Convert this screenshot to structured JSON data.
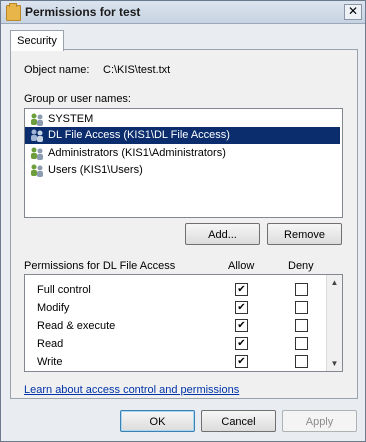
{
  "window": {
    "title": "Permissions for test",
    "close_glyph": "✕"
  },
  "tabs": [
    {
      "label": "Security"
    }
  ],
  "object": {
    "label": "Object name:",
    "value": "C:\\KIS\\test.txt"
  },
  "groups": {
    "label": "Group or user names:",
    "items": [
      {
        "label": "SYSTEM",
        "selected": false,
        "icon": "users-icon"
      },
      {
        "label": "DL File Access (KIS1\\DL File Access)",
        "selected": true,
        "icon": "users-icon"
      },
      {
        "label": "Administrators (KIS1\\Administrators)",
        "selected": false,
        "icon": "users-icon"
      },
      {
        "label": "Users (KIS1\\Users)",
        "selected": false,
        "icon": "users-icon"
      }
    ],
    "add_label": "Add...",
    "remove_label": "Remove"
  },
  "permissions": {
    "title": "Permissions for DL File Access",
    "allow_header": "Allow",
    "deny_header": "Deny",
    "rows": [
      {
        "name": "Full control",
        "allow": true,
        "deny": false
      },
      {
        "name": "Modify",
        "allow": true,
        "deny": false
      },
      {
        "name": "Read & execute",
        "allow": true,
        "deny": false
      },
      {
        "name": "Read",
        "allow": true,
        "deny": false
      },
      {
        "name": "Write",
        "allow": true,
        "deny": false
      }
    ]
  },
  "link": {
    "label": "Learn about access control and permissions"
  },
  "buttons": {
    "ok": "OK",
    "cancel": "Cancel",
    "apply": "Apply"
  },
  "colors": {
    "selection": "#0b2d6e",
    "link": "#0033aa"
  }
}
